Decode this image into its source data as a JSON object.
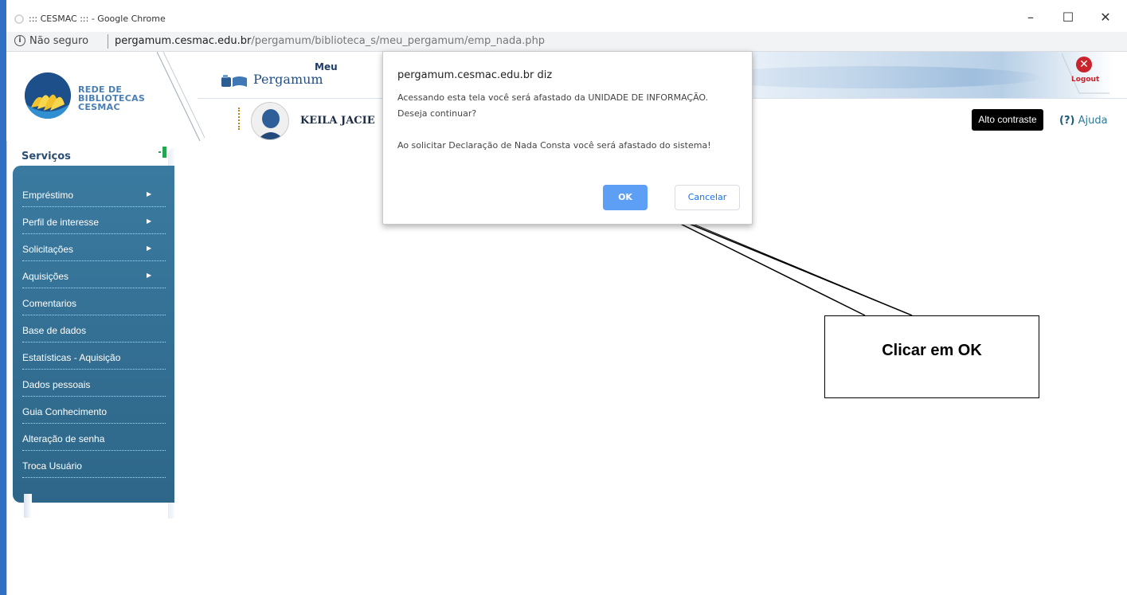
{
  "window": {
    "title": "::: CESMAC ::: - Google Chrome",
    "minimize": "–",
    "maximize": "☐",
    "close": "✕"
  },
  "address_bar": {
    "security_label": "Não seguro",
    "url_domain": "pergamum.cesmac.edu.br",
    "url_path": "/pergamum/biblioteca_s/meu_pergamum/emp_nada.php"
  },
  "header": {
    "logo_text": [
      "REDE DE",
      "BIBLIOTECAS",
      "CESMAC"
    ],
    "meu_label": "Meu",
    "pergamum_label": "Pergamum",
    "user_name": "KEILA JACIE",
    "logout_label": "Logout",
    "alto_contraste_label": "Alto contraste",
    "ajuda_prefix": "(?)",
    "ajuda_label": "Ajuda"
  },
  "sidebar": {
    "title": "Serviços",
    "items": [
      {
        "label": "Empréstimo",
        "has_submenu": true
      },
      {
        "label": "Perfil de interesse",
        "has_submenu": true
      },
      {
        "label": "Solicitações",
        "has_submenu": true
      },
      {
        "label": "Aquisições",
        "has_submenu": true
      },
      {
        "label": "Comentarios",
        "has_submenu": false
      },
      {
        "label": "Base de dados",
        "has_submenu": false
      },
      {
        "label": "Estatísticas - Aquisição",
        "has_submenu": false
      },
      {
        "label": "Dados pessoais",
        "has_submenu": false
      },
      {
        "label": "Guia Conhecimento",
        "has_submenu": false
      },
      {
        "label": "Alteração de senha",
        "has_submenu": false
      },
      {
        "label": "Troca Usuário",
        "has_submenu": false
      }
    ]
  },
  "dialog": {
    "title": "pergamum.cesmac.edu.br diz",
    "message_line1": "Acessando esta tela você será afastado da UNIDADE DE INFORMAÇÃO.",
    "message_line2": "Deseja continuar?",
    "message_line3": "Ao solicitar Declaração de Nada Consta você será afastado do sistema!",
    "ok_label": "OK",
    "cancel_label": "Cancelar"
  },
  "callout": {
    "text": "Clicar em OK"
  },
  "colors": {
    "accent_blue": "#5c9ff5",
    "menu_bg": "#3b7aa0",
    "logout_red": "#c9232b",
    "collapse_green": "#25a551"
  }
}
